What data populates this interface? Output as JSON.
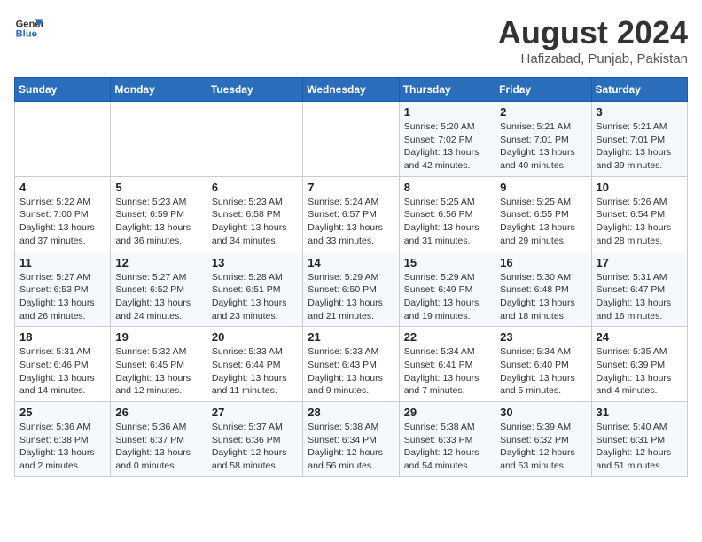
{
  "header": {
    "logo_text_general": "General",
    "logo_text_blue": "Blue",
    "month_year": "August 2024",
    "location": "Hafizabad, Punjab, Pakistan"
  },
  "columns": [
    "Sunday",
    "Monday",
    "Tuesday",
    "Wednesday",
    "Thursday",
    "Friday",
    "Saturday"
  ],
  "weeks": [
    [
      {
        "day": "",
        "detail": ""
      },
      {
        "day": "",
        "detail": ""
      },
      {
        "day": "",
        "detail": ""
      },
      {
        "day": "",
        "detail": ""
      },
      {
        "day": "1",
        "detail": "Sunrise: 5:20 AM\nSunset: 7:02 PM\nDaylight: 13 hours\nand 42 minutes."
      },
      {
        "day": "2",
        "detail": "Sunrise: 5:21 AM\nSunset: 7:01 PM\nDaylight: 13 hours\nand 40 minutes."
      },
      {
        "day": "3",
        "detail": "Sunrise: 5:21 AM\nSunset: 7:01 PM\nDaylight: 13 hours\nand 39 minutes."
      }
    ],
    [
      {
        "day": "4",
        "detail": "Sunrise: 5:22 AM\nSunset: 7:00 PM\nDaylight: 13 hours\nand 37 minutes."
      },
      {
        "day": "5",
        "detail": "Sunrise: 5:23 AM\nSunset: 6:59 PM\nDaylight: 13 hours\nand 36 minutes."
      },
      {
        "day": "6",
        "detail": "Sunrise: 5:23 AM\nSunset: 6:58 PM\nDaylight: 13 hours\nand 34 minutes."
      },
      {
        "day": "7",
        "detail": "Sunrise: 5:24 AM\nSunset: 6:57 PM\nDaylight: 13 hours\nand 33 minutes."
      },
      {
        "day": "8",
        "detail": "Sunrise: 5:25 AM\nSunset: 6:56 PM\nDaylight: 13 hours\nand 31 minutes."
      },
      {
        "day": "9",
        "detail": "Sunrise: 5:25 AM\nSunset: 6:55 PM\nDaylight: 13 hours\nand 29 minutes."
      },
      {
        "day": "10",
        "detail": "Sunrise: 5:26 AM\nSunset: 6:54 PM\nDaylight: 13 hours\nand 28 minutes."
      }
    ],
    [
      {
        "day": "11",
        "detail": "Sunrise: 5:27 AM\nSunset: 6:53 PM\nDaylight: 13 hours\nand 26 minutes."
      },
      {
        "day": "12",
        "detail": "Sunrise: 5:27 AM\nSunset: 6:52 PM\nDaylight: 13 hours\nand 24 minutes."
      },
      {
        "day": "13",
        "detail": "Sunrise: 5:28 AM\nSunset: 6:51 PM\nDaylight: 13 hours\nand 23 minutes."
      },
      {
        "day": "14",
        "detail": "Sunrise: 5:29 AM\nSunset: 6:50 PM\nDaylight: 13 hours\nand 21 minutes."
      },
      {
        "day": "15",
        "detail": "Sunrise: 5:29 AM\nSunset: 6:49 PM\nDaylight: 13 hours\nand 19 minutes."
      },
      {
        "day": "16",
        "detail": "Sunrise: 5:30 AM\nSunset: 6:48 PM\nDaylight: 13 hours\nand 18 minutes."
      },
      {
        "day": "17",
        "detail": "Sunrise: 5:31 AM\nSunset: 6:47 PM\nDaylight: 13 hours\nand 16 minutes."
      }
    ],
    [
      {
        "day": "18",
        "detail": "Sunrise: 5:31 AM\nSunset: 6:46 PM\nDaylight: 13 hours\nand 14 minutes."
      },
      {
        "day": "19",
        "detail": "Sunrise: 5:32 AM\nSunset: 6:45 PM\nDaylight: 13 hours\nand 12 minutes."
      },
      {
        "day": "20",
        "detail": "Sunrise: 5:33 AM\nSunset: 6:44 PM\nDaylight: 13 hours\nand 11 minutes."
      },
      {
        "day": "21",
        "detail": "Sunrise: 5:33 AM\nSunset: 6:43 PM\nDaylight: 13 hours\nand 9 minutes."
      },
      {
        "day": "22",
        "detail": "Sunrise: 5:34 AM\nSunset: 6:41 PM\nDaylight: 13 hours\nand 7 minutes."
      },
      {
        "day": "23",
        "detail": "Sunrise: 5:34 AM\nSunset: 6:40 PM\nDaylight: 13 hours\nand 5 minutes."
      },
      {
        "day": "24",
        "detail": "Sunrise: 5:35 AM\nSunset: 6:39 PM\nDaylight: 13 hours\nand 4 minutes."
      }
    ],
    [
      {
        "day": "25",
        "detail": "Sunrise: 5:36 AM\nSunset: 6:38 PM\nDaylight: 13 hours\nand 2 minutes."
      },
      {
        "day": "26",
        "detail": "Sunrise: 5:36 AM\nSunset: 6:37 PM\nDaylight: 13 hours\nand 0 minutes."
      },
      {
        "day": "27",
        "detail": "Sunrise: 5:37 AM\nSunset: 6:36 PM\nDaylight: 12 hours\nand 58 minutes."
      },
      {
        "day": "28",
        "detail": "Sunrise: 5:38 AM\nSunset: 6:34 PM\nDaylight: 12 hours\nand 56 minutes."
      },
      {
        "day": "29",
        "detail": "Sunrise: 5:38 AM\nSunset: 6:33 PM\nDaylight: 12 hours\nand 54 minutes."
      },
      {
        "day": "30",
        "detail": "Sunrise: 5:39 AM\nSunset: 6:32 PM\nDaylight: 12 hours\nand 53 minutes."
      },
      {
        "day": "31",
        "detail": "Sunrise: 5:40 AM\nSunset: 6:31 PM\nDaylight: 12 hours\nand 51 minutes."
      }
    ]
  ]
}
